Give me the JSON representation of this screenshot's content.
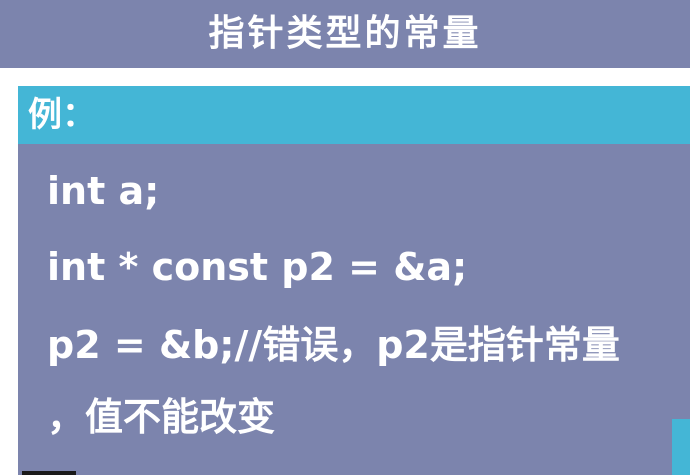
{
  "slide": {
    "title": "指针类型的常量"
  },
  "example": {
    "label": "例：",
    "lines": [
      "int a;",
      "int * const p2 = &a;",
      "p2 = &b;//错误，p2是指针常量",
      "，值不能改变"
    ]
  },
  "colors": {
    "panel": "#7c84ad",
    "accent": "#44b6d6",
    "text": "#ffffff"
  }
}
